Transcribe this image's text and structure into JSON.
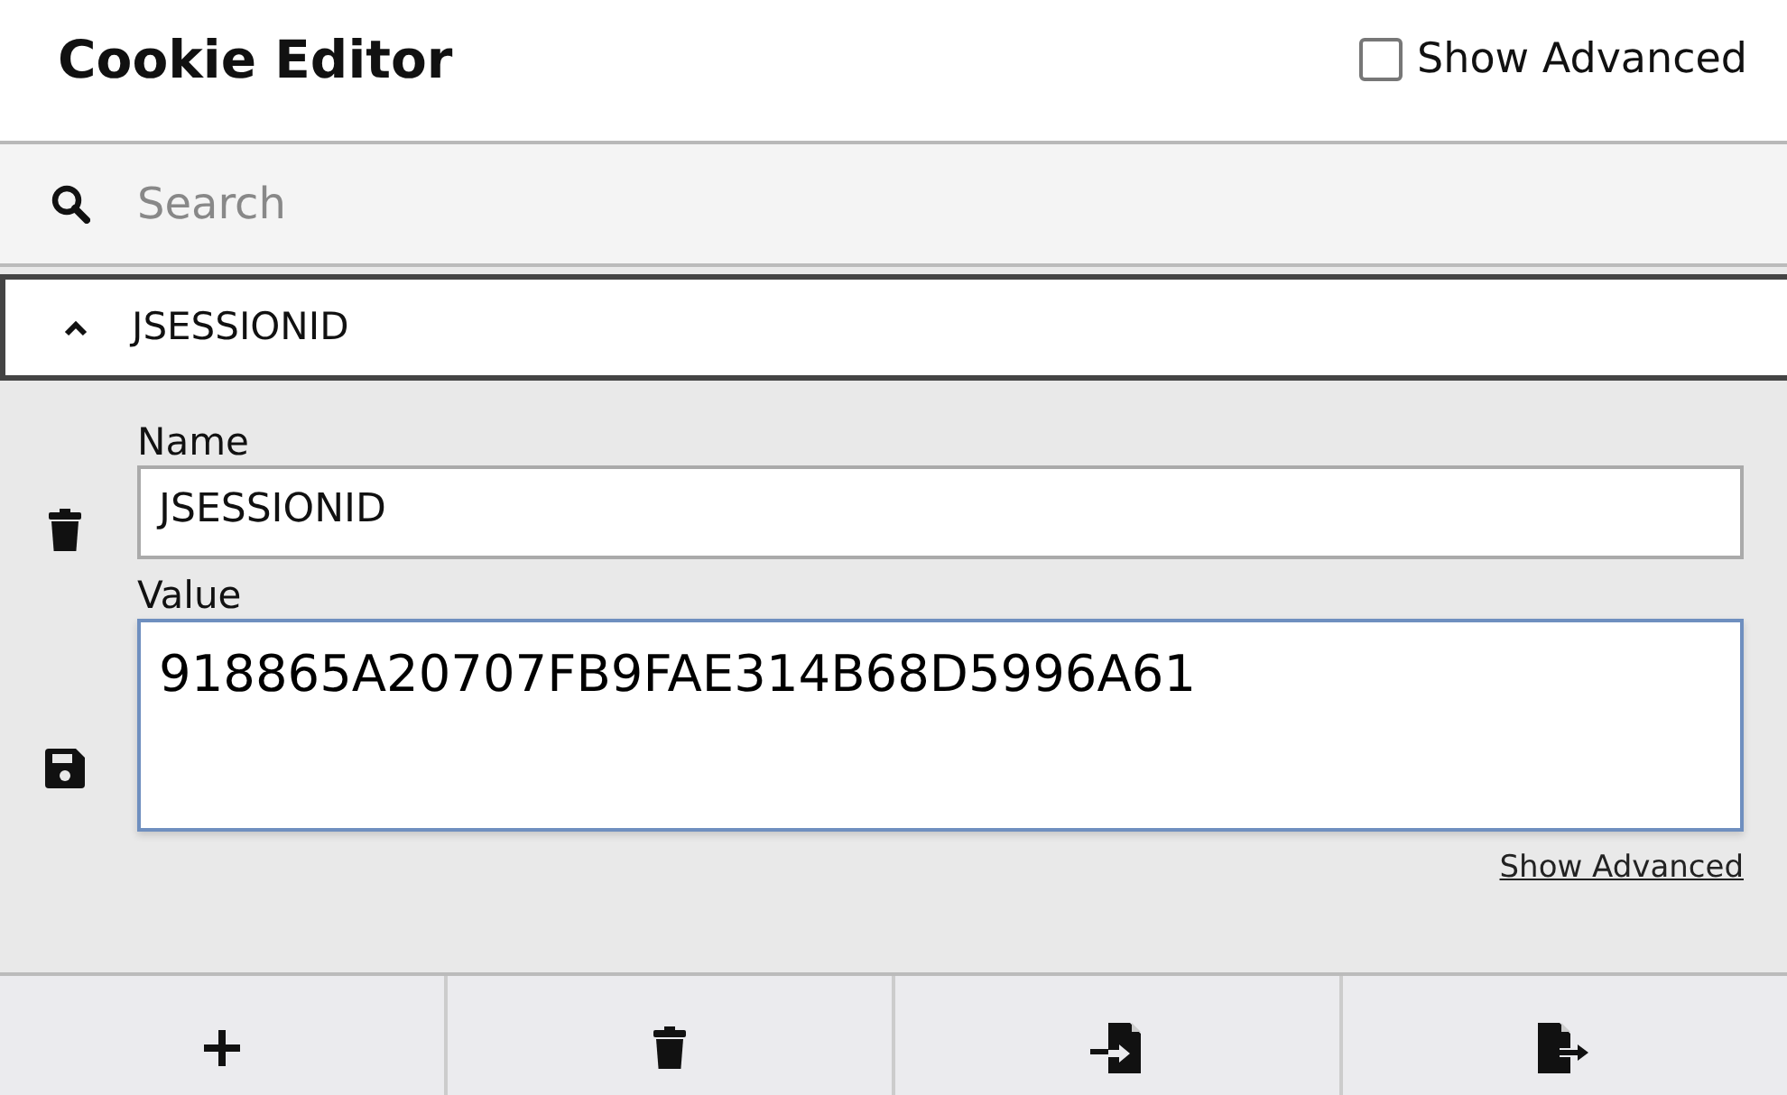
{
  "header": {
    "title": "Cookie Editor",
    "show_advanced": {
      "label": "Show Advanced",
      "checked": false
    }
  },
  "search": {
    "placeholder": "Search"
  },
  "cookies": [
    {
      "name": "JSESSIONID",
      "expanded": true,
      "name_label": "Name",
      "name_value": "JSESSIONID",
      "value_label": "Value",
      "value": "918865A20707FB9FAE314B68D5996A61",
      "advanced_link": "Show Advanced"
    }
  ],
  "buttons": [
    {
      "kind": "add"
    },
    {
      "kind": "delete"
    },
    {
      "kind": "import"
    },
    {
      "kind": "export"
    }
  ]
}
